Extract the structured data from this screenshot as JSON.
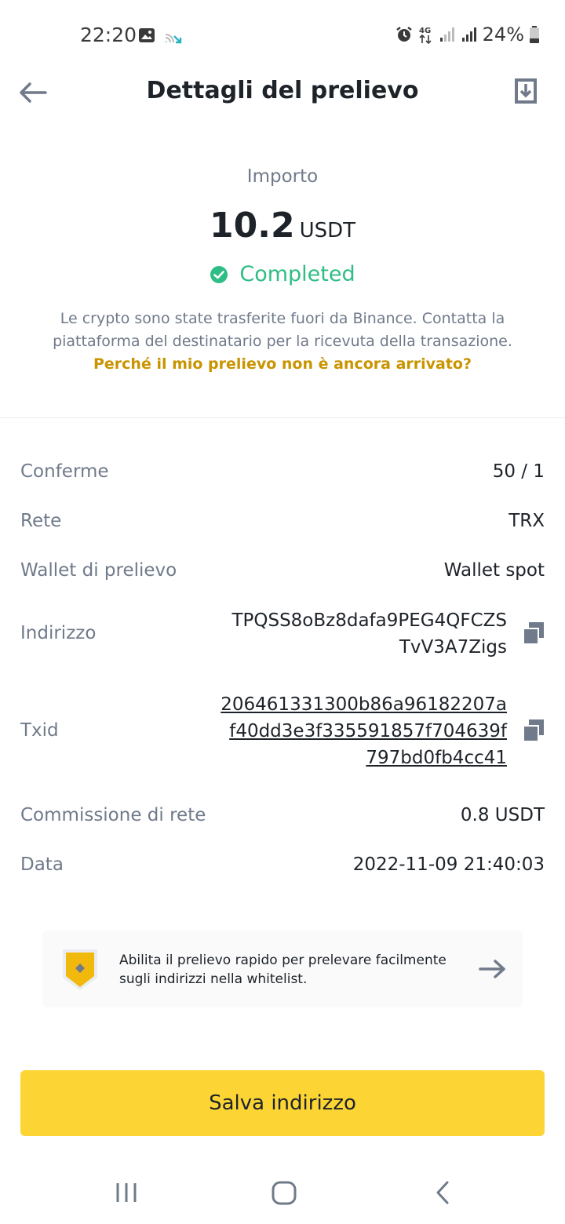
{
  "status_bar": {
    "time": "22:20",
    "battery": "24%",
    "icons": [
      "image-icon",
      "cast-icon",
      "alarm-icon",
      "4g-icon",
      "signal-icon",
      "signal-icon",
      "battery-icon"
    ]
  },
  "header": {
    "title": "Dettagli del prelievo",
    "back_icon": "back-arrow-icon",
    "action_icon": "export-icon"
  },
  "summary": {
    "amount_label": "Importo",
    "amount": "10.2",
    "unit": "USDT",
    "status": "Completed",
    "status_color": "#2ebd85",
    "description": "Le crypto sono state trasferite fuori da Binance. Contatta la piattaforma del destinatario per la ricevuta della transazione.",
    "help_link": "Perché il mio prelievo non è ancora arrivato?"
  },
  "details": {
    "confirmations": {
      "label": "Conferme",
      "value": "50 / 1"
    },
    "network": {
      "label": "Rete",
      "value": "TRX"
    },
    "wallet": {
      "label": "Wallet di prelievo",
      "value": "Wallet spot"
    },
    "address": {
      "label": "Indirizzo",
      "lines": [
        "TPQSS8oBz8dafa9PEG4QFCZS",
        "TvV3A7Zigs"
      ]
    },
    "txid": {
      "label": "Txid",
      "lines": [
        "206461331300b86a96182207a",
        "f40dd3e3f335591857f704639f",
        "797bd0fb4cc41"
      ]
    },
    "fee": {
      "label": "Commissione di rete",
      "value": "0.8 USDT"
    },
    "date": {
      "label": "Data",
      "value": "2022-11-09 21:40:03"
    }
  },
  "banner": {
    "text": "Abilita il prelievo rapido per prelevare facilmente sugli indirizzi nella whitelist."
  },
  "actions": {
    "save_label": "Salva indirizzo"
  },
  "colors": {
    "accent": "#fcd535",
    "link": "#c99400",
    "muted": "#707a8a",
    "text": "#1e2329"
  }
}
